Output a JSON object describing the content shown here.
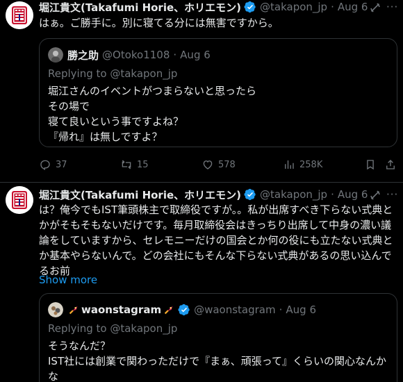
{
  "tweets": [
    {
      "display_name": "堀江貴文(Takafumi Horie、ホリエモン)",
      "handle": "@takapon_jp",
      "separator": "·",
      "date": "Aug 6",
      "text": "はぁ。ご勝手に。別に寝てる分には無害ですから。",
      "quote": {
        "display_name": "勝之助",
        "handle": "@Otoko1108",
        "separator": "·",
        "date": "Aug 6",
        "replying_to": "Replying to @takapon_jp",
        "text": "堀江さんのイベントがつまらないと思ったら\nその場で\n寝て良いという事ですよね？\n『帰れ』は無しですよ？"
      },
      "stats": {
        "replies": "37",
        "reposts": "15",
        "likes": "578",
        "views": "258K"
      }
    },
    {
      "display_name": "堀江貴文(Takafumi Horie、ホリエモン)",
      "handle": "@takapon_jp",
      "separator": "·",
      "date": "Aug 6",
      "text": "は？俺今でもIST筆頭株主で取締役ですが。。私が出席すべき下らない式典とかがそもそもないだけです。毎月取締役会はきっちり出席して中身の濃い議論をしていますから、セレモニーだけの国会とか何の役にも立たない式典とか基本やらないんで。どの会社にもそんな下らない式典があるの思い込んでるお前",
      "show_more": "Show more",
      "quote": {
        "display_name": "waonstagram",
        "handle": "@waonstagram",
        "separator": "·",
        "date": "Aug 6",
        "replying_to": "Replying to @takapon_jp",
        "text": "そうなんだ？\nIST社には創業で関わっただけで『まぁ、頑張って』くらいの関心なんかな"
      }
    }
  ],
  "colors": {
    "background": "#000000",
    "text": "#e7e9ea",
    "muted": "#71767b",
    "accent": "#1d9bf0",
    "border": "#2f3336"
  },
  "icons": {
    "verified": "verified-badge-icon",
    "grok": "grok-icon",
    "more": "more-dots-icon",
    "reply": "reply-icon",
    "repost": "repost-icon",
    "like": "like-icon",
    "views": "views-icon",
    "bookmark": "bookmark-icon",
    "share": "share-icon"
  }
}
